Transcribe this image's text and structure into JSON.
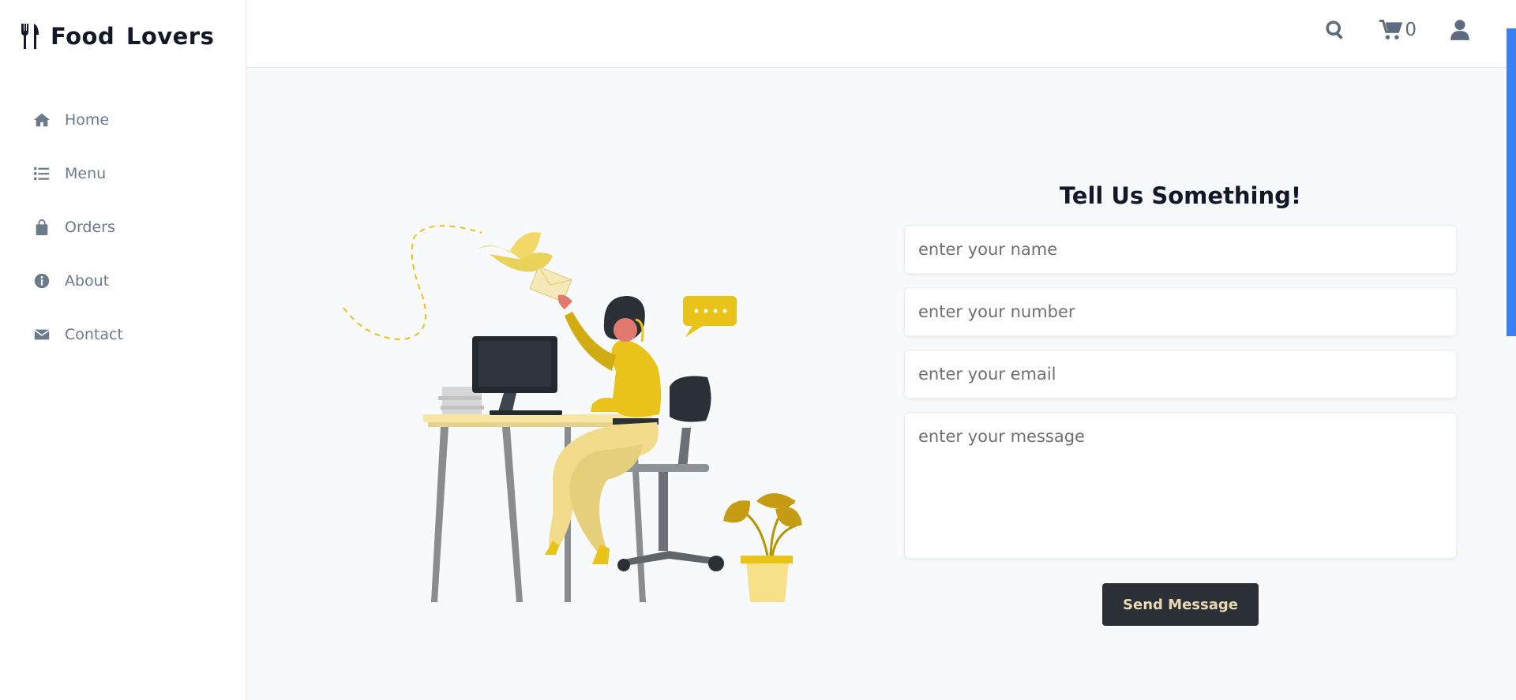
{
  "brand": {
    "name": "Food  Lovers",
    "icon": "utensils-icon"
  },
  "sidebar": {
    "items": [
      {
        "label": "Home",
        "icon": "home-icon"
      },
      {
        "label": "Menu",
        "icon": "list-icon"
      },
      {
        "label": "Orders",
        "icon": "shopping-bag-icon"
      },
      {
        "label": "About",
        "icon": "info-circle-icon"
      },
      {
        "label": "Contact",
        "icon": "envelope-icon"
      }
    ]
  },
  "topbar": {
    "search_icon": "search-icon",
    "cart_icon": "cart-icon",
    "cart_count": "0",
    "user_icon": "user-icon"
  },
  "contact_form": {
    "title": "Tell Us Something!",
    "name_placeholder": "enter your name",
    "number_placeholder": "enter your number",
    "email_placeholder": "enter your email",
    "message_placeholder": "enter your message",
    "submit_label": "Send Message"
  },
  "colors": {
    "accent": "#3b7ff0",
    "illustration_yellow": "#e9c319",
    "button_bg": "#2a3035",
    "button_text": "#e9d9b6",
    "nav_text": "#6b7a8c"
  }
}
